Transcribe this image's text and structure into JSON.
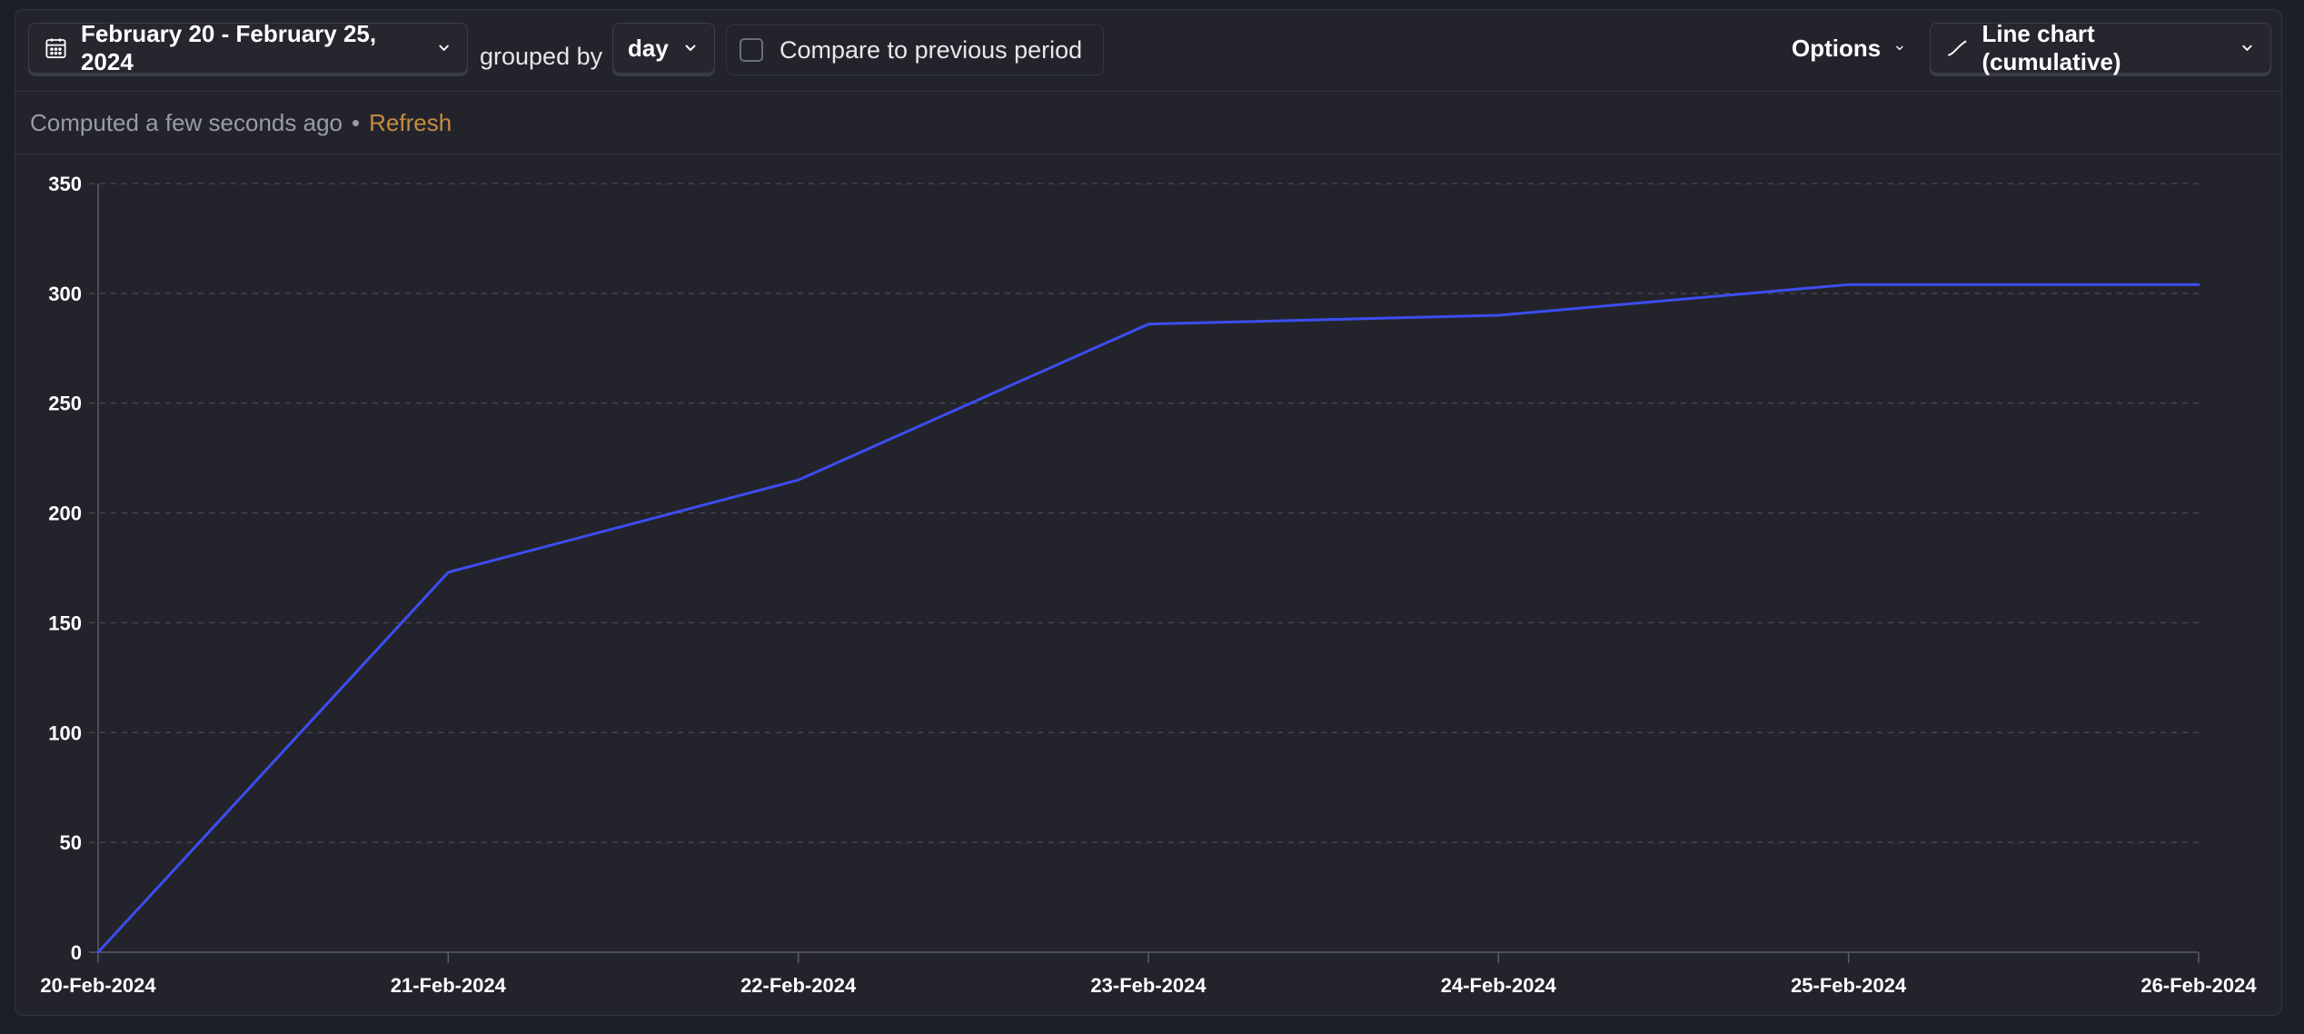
{
  "toolbar": {
    "date_range": "February 20 - February 25, 2024",
    "grouped_by_label": "grouped by",
    "interval": "day",
    "compare_label": "Compare to previous period",
    "compare_checked": false,
    "options_label": "Options",
    "chart_type_label": "Line chart (cumulative)"
  },
  "status": {
    "computed_text": "Computed a few seconds ago",
    "separator": "•",
    "refresh_label": "Refresh"
  },
  "colors": {
    "series_line": "#3b4ef0",
    "refresh_link": "#c68c3f",
    "background": "#23242b"
  },
  "icons": {
    "calendar": "calendar-icon",
    "chevron": "chevron-down-icon",
    "line_chart": "line-chart-icon"
  },
  "chart_data": {
    "type": "line",
    "title": "",
    "xlabel": "",
    "ylabel": "",
    "categories": [
      "20-Feb-2024",
      "21-Feb-2024",
      "22-Feb-2024",
      "23-Feb-2024",
      "24-Feb-2024",
      "25-Feb-2024",
      "26-Feb-2024"
    ],
    "series": [
      {
        "values": [
          0,
          173,
          215,
          286,
          290,
          304,
          304
        ]
      }
    ],
    "yticks": [
      0,
      50,
      100,
      150,
      200,
      250,
      300,
      350
    ],
    "ylim": [
      0,
      350
    ],
    "grid": true,
    "legend": "none"
  }
}
